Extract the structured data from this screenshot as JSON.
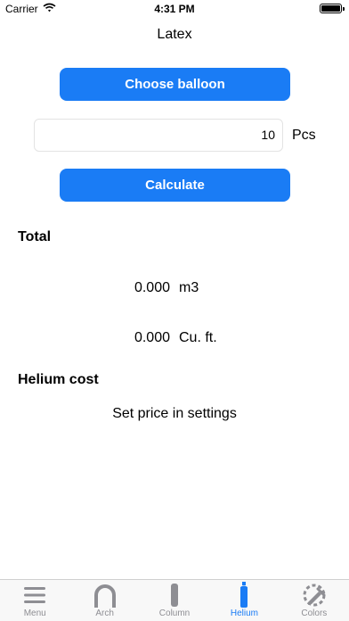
{
  "status_bar": {
    "carrier": "Carrier",
    "time": "4:31 PM"
  },
  "header": {
    "title": "Latex"
  },
  "form": {
    "choose_label": "Choose balloon",
    "quantity_value": "10",
    "quantity_unit": "Pcs",
    "calculate_label": "Calculate"
  },
  "total": {
    "heading": "Total",
    "rows": [
      {
        "value": "0.000",
        "unit": "m3"
      },
      {
        "value": "0.000",
        "unit": "Cu. ft."
      }
    ]
  },
  "cost": {
    "heading": "Helium cost",
    "note": "Set price in settings"
  },
  "tab_bar": {
    "accent_color": "#1a7cf5",
    "inactive_color": "#8e8e93",
    "tabs": [
      {
        "label": "Menu",
        "icon": "menu-icon",
        "active": false
      },
      {
        "label": "Arch",
        "icon": "arch-icon",
        "active": false
      },
      {
        "label": "Column",
        "icon": "column-icon",
        "active": false
      },
      {
        "label": "Helium",
        "icon": "helium-tank-icon",
        "active": true
      },
      {
        "label": "Colors",
        "icon": "colors-picker-icon",
        "active": false
      }
    ]
  }
}
